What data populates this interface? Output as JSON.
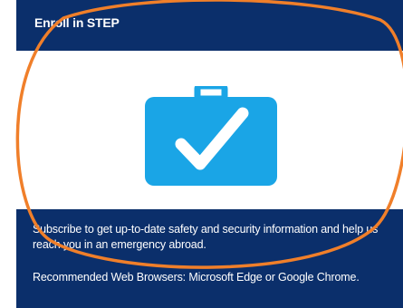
{
  "card": {
    "title": "Enroll in STEP",
    "icon": "briefcase-checkmark-icon",
    "description": "Subscribe to get up-to-date safety and security information and help us reach you in an emergency abroad.",
    "browsers_note": "Recommended Web Browsers: Microsoft Edge or Google Chrome."
  },
  "colors": {
    "card_background": "#0b2f6b",
    "icon_blue": "#1aa5e6",
    "annotation_orange": "#f07f2a"
  },
  "annotation": {
    "shape": "ellipse",
    "color": "#f07f2a"
  }
}
